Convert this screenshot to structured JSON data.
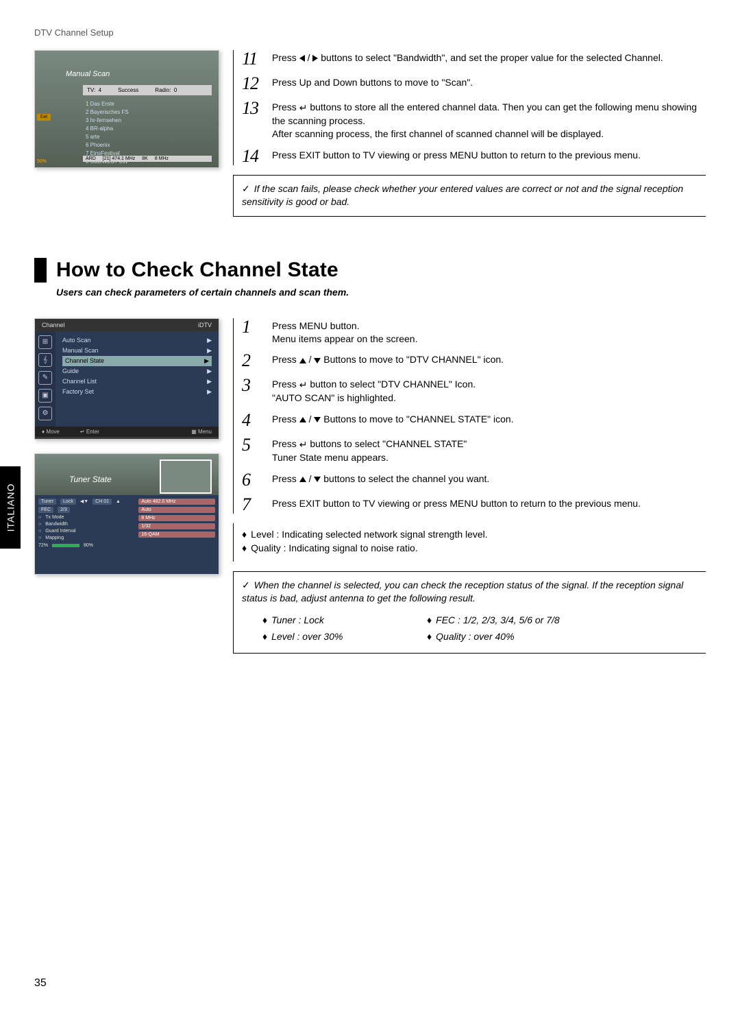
{
  "header": "DTV Channel Setup",
  "language_tab": "ITALIANO",
  "page_number": "35",
  "shot1": {
    "title": "Manual Scan",
    "bar_tv": "TV:",
    "bar_tv_count": "4",
    "bar_success": "Success",
    "bar_radio": "Radio:",
    "bar_radio_count": "0",
    "list": [
      "1   Das Erste",
      "2   Bayerisches FS",
      "3   hr-fernsehen",
      "4   BR-alpha",
      "5   arte",
      "6   Phoenix",
      "7   EinsFestival",
      "8   SÜDWEST BW"
    ],
    "footer_ard": "ARD",
    "footer_freq": "[21] 474.1 MHz",
    "footer_mode": "8K",
    "footer_bw": "8 MHz",
    "left_badge": "Exit",
    "bl1": "50%"
  },
  "steps_top": {
    "s11": {
      "num": "11",
      "pre": "Press ",
      "post": " buttons to select \"Bandwidth\", and set the proper value for the selected Channel."
    },
    "s12": {
      "num": "12",
      "text": "Press Up and Down buttons to move to \"Scan\"."
    },
    "s13": {
      "num": "13",
      "line1_pre": "Press ",
      "line1_post": " buttons to store all the entered channel data. Then you can get the following menu showing the scanning process.",
      "line2": "After scanning process, the first channel of scanned channel will be displayed."
    },
    "s14": {
      "num": "14",
      "text": "Press EXIT button to TV viewing or press MENU button to return to the previous menu."
    }
  },
  "note_top": "If the scan fails, please check whether your entered values are correct or not and the signal reception sensitivity is good or bad.",
  "section": {
    "title": "How to Check Channel State",
    "subtitle": "Users can check parameters of certain channels and scan them."
  },
  "shot2": {
    "head_left": "Channel",
    "head_right": "iDTV",
    "items": [
      "Auto Scan",
      "Manual Scan",
      "Channel State",
      "Guide",
      "Channel List",
      "Factory Set"
    ],
    "highlight_index": 2,
    "foot_move": "Move",
    "foot_enter": "Enter",
    "foot_menu": "Menu"
  },
  "shot3": {
    "title": "Tuner State",
    "tuner_label": "Tuner",
    "tuner_val": "Lock",
    "ch_label": "CH 01",
    "fec_label": "FEC",
    "fec_val": "2/3",
    "rows": [
      "Tx Mode",
      "Bandwidth",
      "Guard Interval",
      "Mapping"
    ],
    "vals_right_top": "Auto 482.0 MHz",
    "vals": [
      "Auto",
      "8 MHz",
      "1/32",
      "16-QAM"
    ],
    "lvl": "72%",
    "qual": "80%"
  },
  "steps_bottom": {
    "s1": {
      "num": "1",
      "l1": "Press MENU button.",
      "l2": "Menu items appear on the screen."
    },
    "s2": {
      "num": "2",
      "pre": "Press ",
      "post": " Buttons to move to \"DTV CHANNEL\" icon."
    },
    "s3": {
      "num": "3",
      "pre": "Press ",
      "post": " button to select \"DTV CHANNEL\" Icon.",
      "l2": "\"AUTO SCAN\" is highlighted."
    },
    "s4": {
      "num": "4",
      "pre": "Press ",
      "post": " Buttons to move to \"CHANNEL STATE\" icon."
    },
    "s5": {
      "num": "5",
      "pre": "Press ",
      "post": " buttons to select  \"CHANNEL STATE\"",
      "l2": "Tuner State menu appears."
    },
    "s6": {
      "num": "6",
      "pre": "Press ",
      "post": " buttons to select the channel you want."
    },
    "s7": {
      "num": "7",
      "text": "Press EXIT button to TV viewing or press MENU button to return to the previous menu."
    }
  },
  "bullets": {
    "b1": "Level : Indicating selected network signal strength level.",
    "b2": "Quality : Indicating signal to noise ratio."
  },
  "note_bottom": {
    "line": "When the channel is selected, you can check the reception status of the signal. If the reception signal status is bad, adjust antenna to get the following result.",
    "c1a": "Tuner : Lock",
    "c1b": "Level : over 30%",
    "c2a": "FEC : 1/2, 2/3, 3/4, 5/6 or 7/8",
    "c2b": "Quality : over 40%"
  }
}
